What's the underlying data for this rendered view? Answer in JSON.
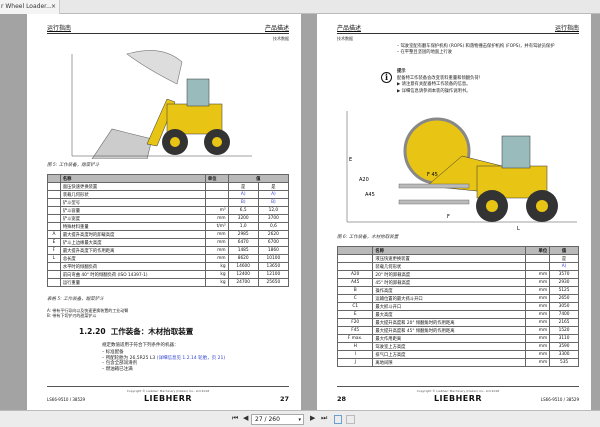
{
  "tab": {
    "title": "r Wheel Loader...",
    "close": "×"
  },
  "left": {
    "header_left": "运行指南",
    "header_right": "产品描述",
    "subheader": "技术数据",
    "figure_caption": "图 5: 工作装备，甜菜铲斗",
    "table": {
      "headers": [
        "",
        "名称",
        "单位",
        "值",
        ""
      ],
      "rows": [
        [
          "",
          "面压快速更换装置",
          "",
          "是",
          "是"
        ],
        [
          "",
          "装载几何形状",
          "",
          "A)",
          "A)"
        ],
        [
          "",
          "铲斗型号",
          "",
          "B)",
          "B)"
        ],
        [
          "",
          "铲斗容量",
          "m³",
          "6,5",
          "12,0"
        ],
        [
          "",
          "铲斗宽度",
          "mm",
          "3200",
          "3700"
        ],
        [
          "",
          "特殊材料重量",
          "t/m³",
          "1,0",
          "0,6"
        ],
        [
          "A",
          "最大提升高度时的卸载高度",
          "mm",
          "2985",
          "2620"
        ],
        [
          "E",
          "铲斗上边缘最大高度",
          "mm",
          "6470",
          "6700"
        ],
        [
          "F",
          "最大提升高度下的作用距离",
          "mm",
          "1485",
          "1860"
        ],
        [
          "L",
          "总长度",
          "mm",
          "8620",
          "10100"
        ],
        [
          "",
          "水平时的倾翻负荷",
          "kg",
          "14600",
          "13650"
        ],
        [
          "",
          "前向弯曲 40° 时的倾翻负荷 (ISO 14397-1)",
          "kg",
          "12400",
          "12100"
        ],
        [
          "",
          "运行重量",
          "kg",
          "24700",
          "25650"
        ]
      ]
    },
    "table_caption": "表格 5: 工作装备，甜菜铲斗",
    "notes": [
      "A: 带有平行导向以及快速更换装置的工业动臂",
      "B: 带有下切铲刃的甜菜铲斗"
    ],
    "section_number": "1.2.20",
    "section_title": "工作装备：木材抬取装置",
    "intro": "规定数值适用于符合下列条件的机器：",
    "bullets": [
      "标准配备",
      "所配轮胎为 26,5R25 L3",
      "包含全部润滑剂",
      "燃油箱已注满"
    ],
    "link": "(详细信息见 1.2.14 轮胎，页 21)",
    "footer_code": "LS66-9510 / 38529",
    "copyright": "Copyright © Liebherr Machinery (Dalian) Co., Ltd 2018",
    "logo": "LIEBHERR",
    "page_number": "27"
  },
  "right": {
    "header_left": "产品描述",
    "header_right": "运行指南",
    "subheader": "技术数据",
    "bullets": [
      "驾驶室配有翻车保护机构 (ROPS) 和落物撞击保护机构 (FOPS)，并有驾驶员保护",
      "在平整且坚固的地面上行驶"
    ],
    "info_title": "提示",
    "info_text": "配备特工作装备会改变装料重量和倾翻负荷！",
    "info_items": [
      "请注意有关配备特工作装备的信息。",
      "详细信息请参阅本装的操作说明书。"
    ],
    "figure_caption": "图 6: 工作装备，木材抬取装置",
    "dims": [
      "A20",
      "A45",
      "F 45",
      "F",
      "E",
      "L"
    ],
    "table": {
      "headers": [
        "",
        "名称",
        "单位",
        "值"
      ],
      "rows": [
        [
          "",
          "液压快速更换装置",
          "",
          "是"
        ],
        [
          "",
          "装载几何形状",
          "",
          "A)"
        ],
        [
          "A20",
          "20° 时的卸载高度",
          "mm",
          "3570"
        ],
        [
          "A45",
          "45° 时的卸载高度",
          "mm",
          "2930"
        ],
        [
          "B",
          "操作高度",
          "mm",
          "5125"
        ],
        [
          "C",
          "运输位置的最大抓斗开口",
          "mm",
          "2650"
        ],
        [
          "C1",
          "最大抓斗开口",
          "mm",
          "3050"
        ],
        [
          "E",
          "最大高度",
          "mm",
          "7400"
        ],
        [
          "F20",
          "最大提升高度和 20° 倾翻角时的作用距离",
          "mm",
          "2165"
        ],
        [
          "F45",
          "最大提升高度和 45° 倾翻角时的作用距离",
          "mm",
          "1520"
        ],
        [
          "F max.",
          "最大作用距离",
          "mm",
          "3110"
        ],
        [
          "H",
          "驾驶室上方高度",
          "mm",
          "3590"
        ],
        [
          "I",
          "排气口上方高度",
          "mm",
          "3300"
        ],
        [
          "J",
          "离地间隙",
          "mm",
          "535"
        ]
      ]
    },
    "footer_code": "LS66-9510 / 38529",
    "copyright": "Copyright © Liebherr Machinery (Dalian) Co., Ltd 2018",
    "logo": "LIEBHERR",
    "page_number": "28"
  },
  "toolbar": {
    "page_value": "27 / 260",
    "first": "⏮",
    "prev": "◀",
    "next": "▶",
    "last": "⏭"
  },
  "colors": {
    "machine_yellow": "#e8c414",
    "link_blue": "#3344cc"
  }
}
